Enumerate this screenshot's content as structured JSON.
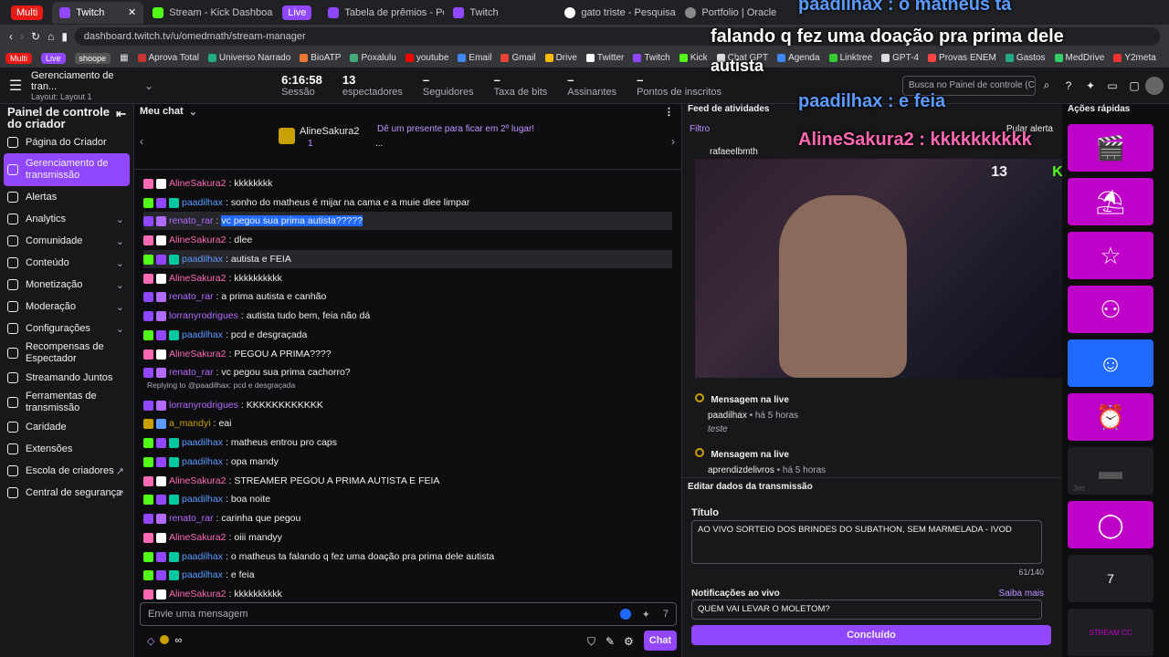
{
  "browser": {
    "tabs": [
      {
        "label": "Multi",
        "color": "#e91916"
      },
      {
        "label": "Twitch",
        "color": "#9147ff"
      },
      {
        "label": "Stream - Kick Dashboard",
        "color": "#53fc18"
      },
      {
        "label": "Live",
        "color": "#9147ff"
      },
      {
        "label": "Tabela de prêmios - Post pa",
        "color": "#9147ff"
      },
      {
        "label": "Twitch",
        "color": "#9147ff"
      },
      {
        "label": "gato triste - Pesquisa Googl",
        "color": "#4285f4"
      },
      {
        "label": "Portfolio | Oracle Code",
        "color": "#888888"
      }
    ],
    "url": "dashboard.twitch.tv/u/omedmath/stream-manager",
    "bookmarks": [
      "Multi",
      "Live",
      "shoope",
      "Aprova Total",
      "Universo Narrado",
      "BioATP",
      "Poxalulu",
      "youtube",
      "Email",
      "Gmail",
      "Drive",
      "Twitter",
      "Twitch",
      "Kick",
      "Chat GPT",
      "Agenda",
      "Linktree",
      "GPT-4",
      "Provas ENEM",
      "Gastos",
      "MedDrive",
      "Y2meta"
    ]
  },
  "topbar": {
    "title": "Gerenciamento de tran...",
    "layout": "Layout: Layout 1",
    "stats": [
      {
        "v": "6:16:58",
        "l": "Sessão"
      },
      {
        "v": "13",
        "l": "espectadores"
      },
      {
        "v": "–",
        "l": "Seguidores"
      },
      {
        "v": "–",
        "l": "Taxa de bits"
      },
      {
        "v": "–",
        "l": "Assinantes"
      },
      {
        "v": "–",
        "l": "Pontos de inscritos"
      }
    ],
    "search": "Busca no Painel de controle (C"
  },
  "sidebar": {
    "title": "Painel de controle do criador",
    "items": [
      {
        "label": "Página do Criador"
      },
      {
        "label": "Gerenciamento de transmissão"
      },
      {
        "label": "Alertas"
      },
      {
        "label": "Analytics"
      },
      {
        "label": "Comunidade"
      },
      {
        "label": "Conteúdo"
      },
      {
        "label": "Monetização"
      },
      {
        "label": "Moderação"
      },
      {
        "label": "Configurações"
      },
      {
        "label": "Recompensas de Espectador"
      },
      {
        "label": "Streamando Juntos"
      },
      {
        "label": "Ferramentas de transmissão"
      },
      {
        "label": "Caridade"
      },
      {
        "label": "Extensões"
      },
      {
        "label": "Escola de criadores"
      },
      {
        "label": "Central de segurança"
      }
    ]
  },
  "chat": {
    "header": "Meu chat",
    "pinned_name": "AlineSakura2",
    "pinned_count": "1",
    "pinned_text": "Dê um presente para ficar em 2º lugar!",
    "pinned_more": "...",
    "reply_note": "Replying to @paadilhax: pcd e desgraçada",
    "messages": [
      {
        "n": "AlineSakura2",
        "c": "#ff69b4",
        "t": "kkkkkkkk"
      },
      {
        "n": "paadilhax",
        "c": "#5b9bff",
        "t": "sonho do matheus é mijar na cama e a muie dlee limpar"
      },
      {
        "n": "renato_rar",
        "c": "#b36bff",
        "t": "vc pegou sua prima autista?????"
      },
      {
        "n": "AlineSakura2",
        "c": "#ff69b4",
        "t": "dlee"
      },
      {
        "n": "paadilhax",
        "c": "#5b9bff",
        "t": "autista e FEIA"
      },
      {
        "n": "AlineSakura2",
        "c": "#ff69b4",
        "t": "kkkkkkkkkk"
      },
      {
        "n": "renato_rar",
        "c": "#b36bff",
        "t": "a prima autista e canhão"
      },
      {
        "n": "lorranyrodrigues",
        "c": "#b36bff",
        "t": "autista tudo bem, feia não dá"
      },
      {
        "n": "paadilhax",
        "c": "#5b9bff",
        "t": "pcd e desgraçada"
      },
      {
        "n": "AlineSakura2",
        "c": "#ff69b4",
        "t": "PEGOU A PRIMA????"
      },
      {
        "n": "renato_rar",
        "c": "#b36bff",
        "t": "vc pegou sua prima cachorro?"
      },
      {
        "n": "lorranyrodrigues",
        "c": "#b36bff",
        "t": "KKKKKKKKKKKK"
      },
      {
        "n": "a_mandyi",
        "c": "#c8a100",
        "t": "eai"
      },
      {
        "n": "paadilhax",
        "c": "#5b9bff",
        "t": "matheus entrou pro caps"
      },
      {
        "n": "paadilhax",
        "c": "#5b9bff",
        "t": "opa mandy"
      },
      {
        "n": "AlineSakura2",
        "c": "#ff69b4",
        "t": "STREAMER PEGOU A PRIMA AUTISTA E FEIA"
      },
      {
        "n": "paadilhax",
        "c": "#5b9bff",
        "t": "boa noite"
      },
      {
        "n": "renato_rar",
        "c": "#b36bff",
        "t": "carinha que pegou"
      },
      {
        "n": "AlineSakura2",
        "c": "#ff69b4",
        "t": "oiii mandyy"
      },
      {
        "n": "paadilhax",
        "c": "#5b9bff",
        "t": "o matheus ta falando q fez uma doação pra prima dele autista"
      },
      {
        "n": "paadilhax",
        "c": "#5b9bff",
        "t": "e feia"
      },
      {
        "n": "AlineSakura2",
        "c": "#ff69b4",
        "t": "kkkkkkkkkk"
      }
    ],
    "placeholder": "Envie uma mensagem",
    "send": "Chat",
    "points": "∞"
  },
  "feed": {
    "header": "Feed de atividades",
    "filter": "Filtro",
    "skip": "Pular alerta",
    "top_user": "rafaeelbmth",
    "viewers": "13",
    "kick_viewers": "0",
    "events": [
      {
        "title": "Mensagem na live",
        "user": "paadilhax",
        "time": "há 5 horas",
        "text": "teste"
      },
      {
        "title": "Mensagem na live",
        "user": "aprendizdelivros",
        "time": "há 5 horas",
        "text": ""
      }
    ],
    "edit_header": "Editar dados da transmissão",
    "title_label": "Título",
    "title_value": "AO VIVO SORTEIO DOS BRINDES DO SUBATHON, SEM MARMELADA - IVOD",
    "count": "61/140",
    "notif_label": "Notificações ao vivo",
    "learn": "Saiba mais",
    "notif_value": "QUEM VAI LEVAR O MOLETOM?",
    "done": "Concluído"
  },
  "quick": {
    "header": "Ações rápidas",
    "time": "3m",
    "stream_cc": "STREAM CC"
  },
  "overlay": {
    "l1": "paadilhax : o matheus ta",
    "l2": "falando q fez uma doação pra prima dele",
    "l3": "autista",
    "l4": "paadilhax : e feia",
    "l5": "AlineSakura2 : kkkkkkkkkk"
  }
}
